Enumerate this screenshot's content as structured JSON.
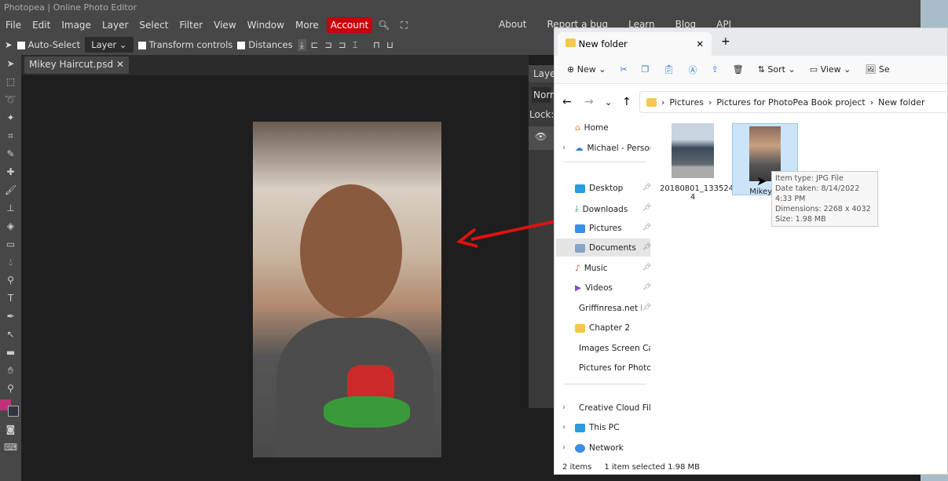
{
  "window_title": "Photopea | Online Photo Editor",
  "menu": [
    "File",
    "Edit",
    "Image",
    "Layer",
    "Select",
    "Filter",
    "View",
    "Window",
    "More"
  ],
  "account_label": "Account",
  "right_menu": [
    "About",
    "Report a bug",
    "Learn",
    "Blog",
    "API"
  ],
  "options": {
    "auto_select": "Auto-Select",
    "layer_select": "Layer",
    "transform_controls": "Transform controls",
    "distances": "Distances"
  },
  "doc_tab": "Mikey Haircut.psd",
  "layers_panel": {
    "title": "Laye",
    "blend": "Norm",
    "lock": "Lock:"
  },
  "colors": {
    "accent": "#c8000a",
    "foreground": "#c2307a",
    "background": "#2e3540"
  },
  "explorer": {
    "tab_title": "New folder",
    "toolbar": {
      "new": "New",
      "sort": "Sort",
      "view": "View",
      "set": "Se"
    },
    "breadcrumb": [
      "Pictures",
      "Pictures for PhotoPea Book project",
      "New folder"
    ],
    "sidebar": {
      "home": "Home",
      "onedrive": "Michael - Personal",
      "pinned": [
        "Desktop",
        "Downloads",
        "Pictures",
        "Documents",
        "Music",
        "Videos",
        "Griffinresa.net R"
      ],
      "folders": [
        "Chapter 2",
        "Images Screen Cap",
        "Pictures for PhotoP"
      ],
      "bottom": [
        "Creative Cloud Files",
        "This PC",
        "Network"
      ]
    },
    "files": [
      {
        "name": "20180801_133524",
        "name_line2": "4"
      },
      {
        "name": "Mikey H"
      }
    ],
    "tooltip": [
      "Item type: JPG File",
      "Date taken: 8/14/2022 4:33 PM",
      "Dimensions: 2268 x 4032",
      "Size: 1.98 MB"
    ],
    "status": {
      "count": "2 items",
      "selected": "1 item selected",
      "size": "1.98 MB"
    }
  }
}
